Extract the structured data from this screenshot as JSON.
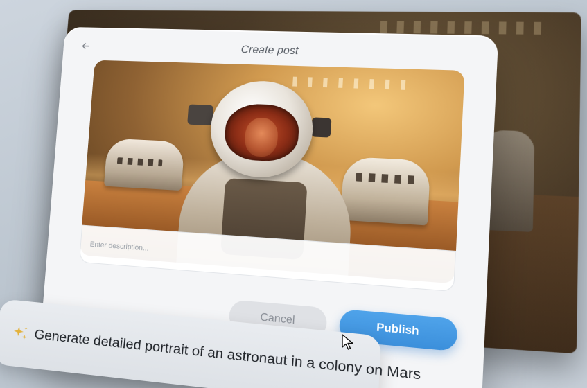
{
  "dialog": {
    "title": "Create post",
    "back_icon": "arrow-left-icon",
    "image_alt": "Astronaut portrait in a Mars colony",
    "description_placeholder": "Enter description...",
    "description_value": "",
    "cancel_label": "Cancel",
    "publish_label": "Publish"
  },
  "prompt": {
    "icon": "sparkle-icon",
    "text": "Generate detailed portrait of an astronaut in a colony on Mars"
  },
  "colors": {
    "accent": "#3b8fdb",
    "dialog_bg": "#f4f5f7",
    "cancel_bg": "#dfe1e5",
    "sparkle": "#e3b23c"
  },
  "cursor": "pointer-arrow-icon"
}
